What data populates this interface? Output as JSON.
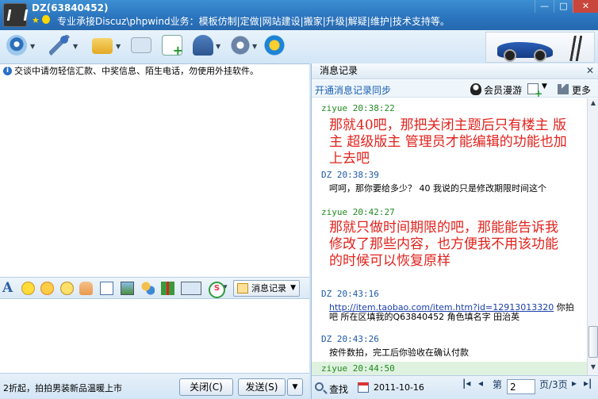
{
  "window": {
    "contact_name": "DZ(63840452)",
    "signature": "专业承接Discuz\\phpwind业务：模板仿制|定做|网站建设|搬家|升级|解疑|维护|技术支持等。",
    "buttons": [
      "—",
      "□",
      "✕"
    ]
  },
  "left": {
    "notice": "交谈中请勿轻信汇款、中奖信息、陌生电话，勿使用外挂软件。",
    "history_button": "消息记录",
    "ad_text": "2折起，拍拍男装新品温暖上市",
    "close_button": "关闭(C)",
    "send_button": "发送(S)"
  },
  "right": {
    "header": "消息记录",
    "sync_link": "开通消息记录同步",
    "roaming": "会员漫游",
    "more": "更多",
    "messages": [
      {
        "sender": "ziyue",
        "time": "20:38:22",
        "text": "那就40吧，那把关闭主题后只有楼主 版主 超级版主 管理员才能编辑的功能也加上去吧"
      },
      {
        "sender": "DZ",
        "time": "20:38:39",
        "text": "呵呵，那你要给多少？ 40 我说的只是修改期限时间这个"
      },
      {
        "sender": "ziyue",
        "time": "20:42:27",
        "text": "那就只做时间期限的吧，那能能告诉我修改了那些内容，也方便我不用该功能的时候可以恢复原样"
      },
      {
        "sender": "DZ",
        "time": "20:43:16",
        "link": "http://item.taobao.com/item.htm?id=12913013320",
        "text": "你拍吧  所在区填我的Q63840452  角色填名字 田治英"
      },
      {
        "sender": "DZ",
        "time": "20:43:26",
        "text": "按件数拍，完工后你验收在确认付款"
      },
      {
        "sender": "ziyue",
        "time": "20:44:50",
        "text": ""
      }
    ],
    "footer": {
      "find": "查找",
      "date": "2011-10-16",
      "page_prefix": "第",
      "page_value": "2",
      "page_suffix": "页/3页"
    }
  }
}
